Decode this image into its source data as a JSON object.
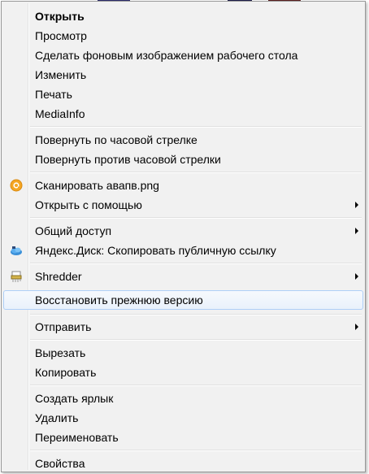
{
  "menu": {
    "open": "Открыть",
    "preview": "Просмотр",
    "set_wallpaper": "Сделать фоновым изображением рабочего стола",
    "edit": "Изменить",
    "print": "Печать",
    "mediainfo": "MediaInfo",
    "rotate_cw": "Повернуть по часовой стрелке",
    "rotate_ccw": "Повернуть против часовой стрелки",
    "scan": "Сканировать авапв.png",
    "open_with": "Открыть с помощью",
    "share": "Общий доступ",
    "yandex_disk": "Яндекс.Диск: Скопировать публичную ссылку",
    "shredder": "Shredder",
    "restore": "Восстановить прежнюю версию",
    "send_to": "Отправить",
    "cut": "Вырезать",
    "copy": "Копировать",
    "create_shortcut": "Создать ярлык",
    "delete": "Удалить",
    "rename": "Переименовать",
    "properties": "Свойства"
  },
  "icons": {
    "scan": "antivirus-scan-icon",
    "yandex": "yandex-disk-icon",
    "shredder": "shredder-icon"
  },
  "colors": {
    "menu_bg": "#f1f1f1",
    "highlight_border": "#aecff7",
    "scan_icon": "#f5a623",
    "yandex_icon": "#3a8fd8"
  }
}
